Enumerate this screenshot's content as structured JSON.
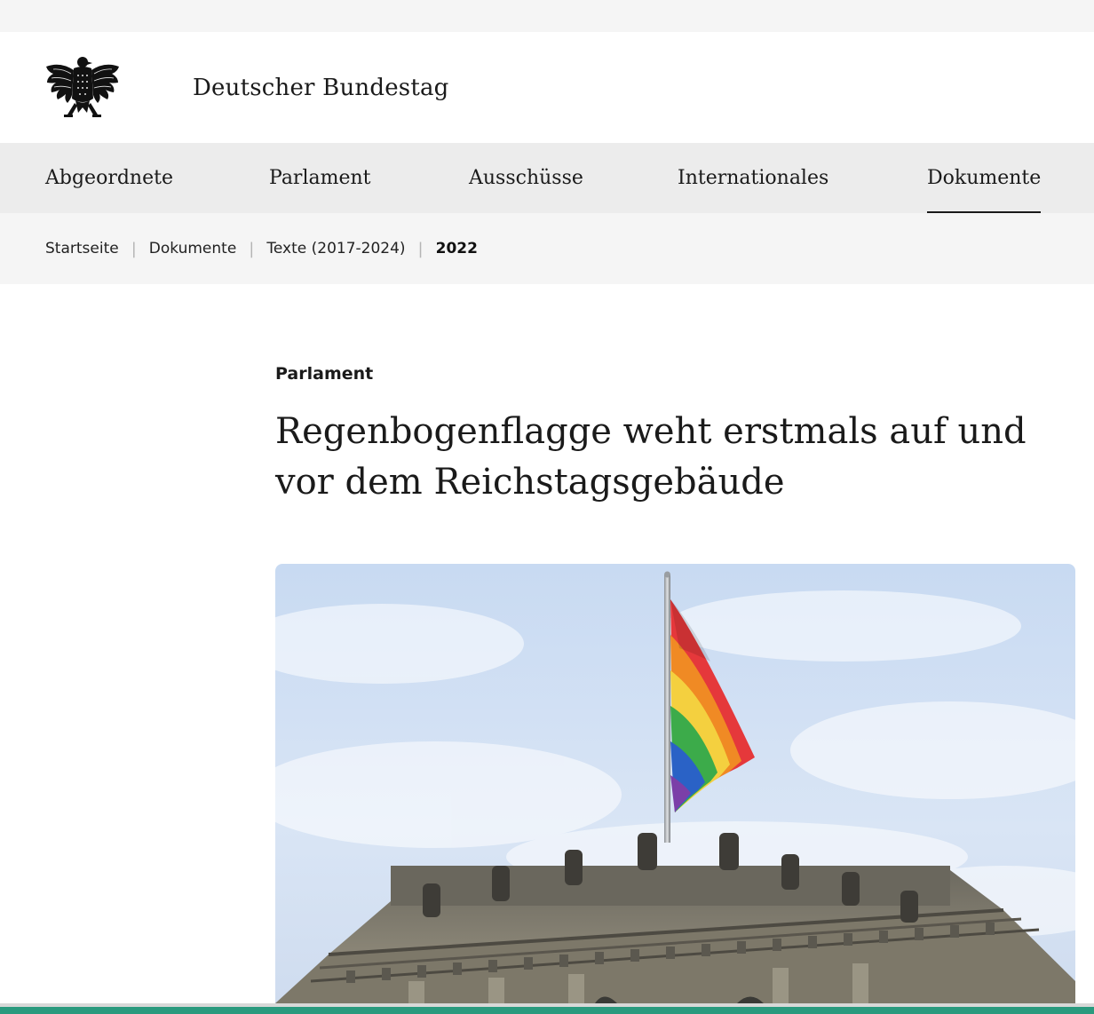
{
  "header": {
    "site_title": "Deutscher Bundestag",
    "logo_icon": "federal-eagle-icon"
  },
  "nav": {
    "items": [
      {
        "label": "Abgeordnete"
      },
      {
        "label": "Parlament"
      },
      {
        "label": "Ausschüsse"
      },
      {
        "label": "Internationales"
      },
      {
        "label": "Dokumente",
        "active": true
      }
    ]
  },
  "breadcrumb": {
    "items": [
      "Startseite",
      "Dokumente",
      "Texte (2017-2024)"
    ],
    "current": "2022",
    "separator": "|"
  },
  "article": {
    "kicker": "Parlament",
    "headline": "Regenbogenflagge weht erstmals auf und vor dem Reichstagsgebäude",
    "hero_image": "rainbow-flag-on-reichstag-photo"
  },
  "colors": {
    "nav_bg": "#ececec",
    "breadcrumb_bg": "#f5f5f5",
    "accent_bottom": "#2a9a7e"
  }
}
